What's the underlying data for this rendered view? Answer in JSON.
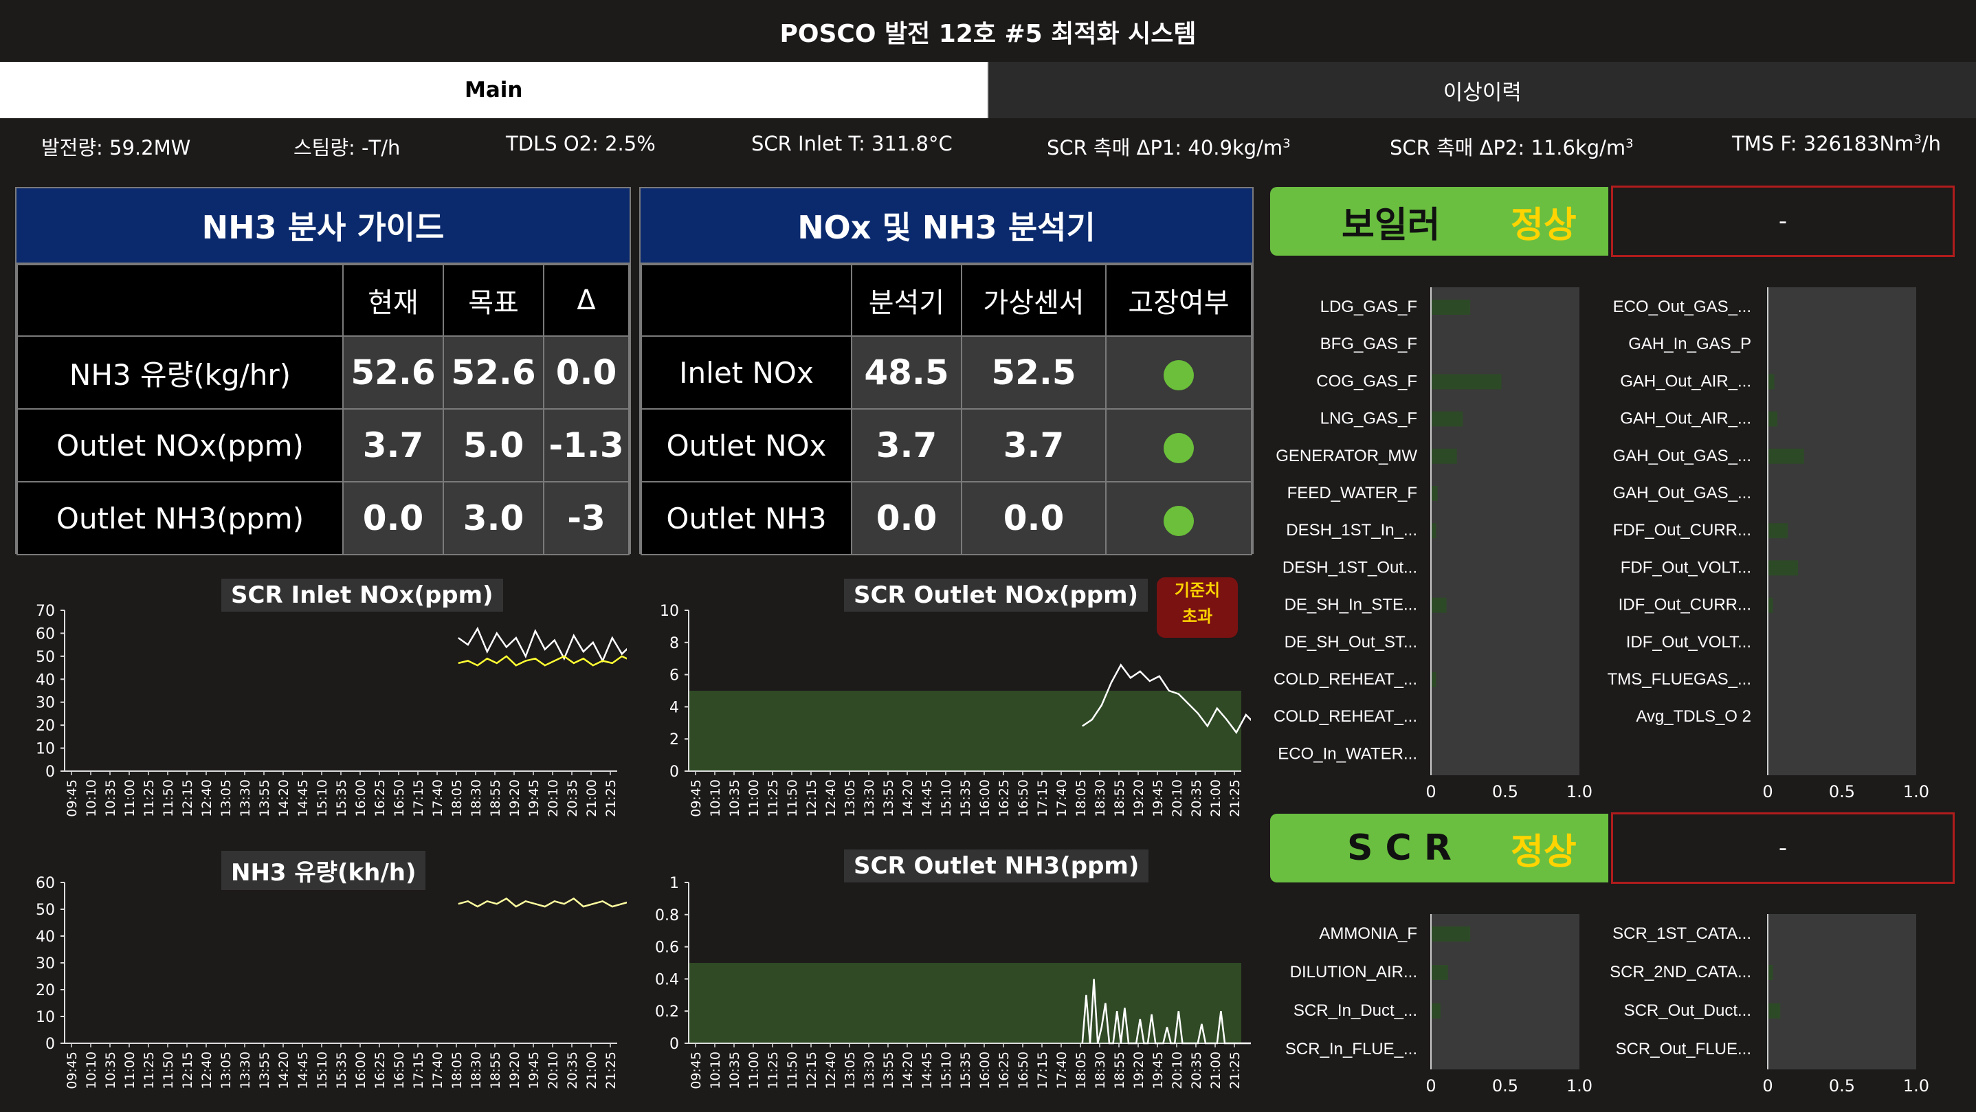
{
  "app": {
    "title": "POSCO 발전 12호 #5 최적화 시스템"
  },
  "tabs": [
    {
      "label": "Main"
    },
    {
      "label": "이상이력"
    }
  ],
  "status": {
    "power": "발전량: 59.2MW",
    "steam": "스팀량: -T/h",
    "o2": "TDLS O2: 2.5%",
    "inlet_t": "SCR Inlet T: 311.8°C",
    "dp1": "SCR 촉매 ΔP1: 40.9kg/m",
    "dp2": "SCR 촉매 ΔP2: 11.6kg/m",
    "tms": "TMS F: 326183Nm",
    "tms_unit": "/h",
    "sup3": "3"
  },
  "nh3_guide": {
    "title": "NH3 분사 가이드",
    "headers": [
      "현재",
      "목표",
      "Δ"
    ],
    "rows": [
      {
        "label": "NH3 유량(kg/hr)",
        "v": [
          "52.6",
          "52.6",
          "0.0"
        ]
      },
      {
        "label": "Outlet NOx(ppm)",
        "v": [
          "3.7",
          "5.0",
          "-1.3"
        ]
      },
      {
        "label": "Outlet NH3(ppm)",
        "v": [
          "0.0",
          "3.0",
          "-3"
        ]
      }
    ]
  },
  "analyzer": {
    "title": "NOx 및 NH3 분석기",
    "headers": [
      "분석기",
      "가상센서",
      "고장여부"
    ],
    "rows": [
      {
        "label": "Inlet NOx",
        "v": [
          "48.5",
          "52.5"
        ],
        "ok": true
      },
      {
        "label": "Outlet NOx",
        "v": [
          "3.7",
          "3.7"
        ],
        "ok": true
      },
      {
        "label": "Outlet NH3",
        "v": [
          "0.0",
          "0.0"
        ],
        "ok": true
      }
    ],
    "ok_color": "#6bbf3a"
  },
  "time_labels": [
    "09:45",
    "10:10",
    "10:35",
    "11:00",
    "11:25",
    "11:50",
    "12:15",
    "12:40",
    "13:05",
    "13:30",
    "13:55",
    "14:20",
    "14:45",
    "15:10",
    "15:35",
    "16:00",
    "16:25",
    "16:50",
    "17:15",
    "17:40",
    "18:05",
    "18:30",
    "18:55",
    "19:20",
    "19:45",
    "20:10",
    "20:35",
    "21:00",
    "21:25"
  ],
  "chart_data": [
    {
      "id": "inlet_nox",
      "type": "line",
      "title": "SCR Inlet NOx(ppm)",
      "ylim": [
        0,
        70
      ],
      "yticks": [
        0,
        10,
        20,
        30,
        40,
        50,
        60,
        70
      ],
      "series": [
        {
          "color": "#ffffff",
          "t": [
            20.1,
            20.6,
            21.1,
            21.6,
            22.1,
            22.6,
            23.1,
            23.6,
            24.1,
            24.6,
            25.1,
            25.6,
            26.1,
            26.6,
            27.1,
            27.6,
            28.1,
            28.6,
            29.1,
            29.6,
            30.1
          ],
          "values": [
            58,
            55,
            62,
            52,
            60,
            54,
            58,
            50,
            61,
            53,
            57,
            49,
            59,
            52,
            56,
            48,
            58,
            51,
            55,
            50,
            54
          ]
        },
        {
          "color": "#ffff33",
          "t": [
            20.1,
            20.6,
            21.1,
            21.6,
            22.1,
            22.6,
            23.1,
            23.6,
            24.1,
            24.6,
            25.1,
            25.6,
            26.1,
            26.6,
            27.1,
            27.6,
            28.1,
            28.6,
            29.1,
            29.6,
            30.1
          ],
          "values": [
            47,
            48,
            46,
            49,
            47,
            50,
            46,
            48,
            49,
            46,
            48,
            50,
            47,
            49,
            46,
            48,
            47,
            50,
            48,
            47,
            49
          ]
        }
      ]
    },
    {
      "id": "outlet_nox",
      "type": "line",
      "title": "SCR Outlet NOx(ppm)",
      "ylim": [
        0,
        10
      ],
      "yticks": [
        0,
        2,
        4,
        6,
        8,
        10
      ],
      "threshold": 5,
      "badge": [
        "기준치",
        "초과"
      ],
      "series": [
        {
          "color": "#ffffff",
          "t": [
            20.1,
            20.6,
            21.1,
            21.6,
            22.1,
            22.6,
            23.1,
            23.6,
            24.1,
            24.6,
            25.1,
            25.6,
            26.1,
            26.6,
            27.1,
            27.6,
            28.1,
            28.6,
            29.1,
            29.6,
            30.1
          ],
          "values": [
            2.8,
            3.2,
            4.1,
            5.5,
            6.6,
            5.8,
            6.2,
            5.6,
            5.9,
            5.0,
            4.8,
            4.2,
            3.6,
            2.8,
            3.9,
            3.2,
            2.4,
            3.5,
            2.9,
            3.8,
            3.7
          ]
        }
      ]
    },
    {
      "id": "nh3_flow",
      "type": "line",
      "title": "NH3 유량(kh/h)",
      "ylim": [
        0,
        60
      ],
      "yticks": [
        0,
        10,
        20,
        30,
        40,
        50,
        60
      ],
      "series": [
        {
          "color": "#ffffa0",
          "t": [
            20.1,
            20.6,
            21.1,
            21.6,
            22.1,
            22.6,
            23.1,
            23.6,
            24.1,
            24.6,
            25.1,
            25.6,
            26.1,
            26.6,
            27.1,
            27.6,
            28.1,
            28.6,
            29.1,
            29.6,
            30.1
          ],
          "values": [
            52,
            53,
            51,
            53,
            52,
            54,
            51,
            53,
            52,
            51,
            53,
            52,
            54,
            51,
            52,
            53,
            51,
            52,
            53,
            52,
            52
          ]
        }
      ]
    },
    {
      "id": "outlet_nh3",
      "type": "line",
      "title": "SCR Outlet NH3(ppm)",
      "ylim": [
        0,
        1.0
      ],
      "yticks": [
        0,
        0.2,
        0.4,
        0.6,
        0.8,
        1.0
      ],
      "threshold": 0.5,
      "series": [
        {
          "color": "#ffffff",
          "t": [
            20.1,
            20.3,
            20.5,
            20.7,
            20.9,
            21.1,
            21.3,
            21.5,
            21.7,
            21.9,
            22.1,
            22.3,
            22.5,
            22.7,
            22.9,
            23.1,
            23.3,
            23.5,
            23.7,
            23.9,
            24.1,
            24.3,
            24.5,
            24.7,
            24.9,
            25.1,
            25.3,
            25.5,
            25.7,
            25.9,
            26.1,
            26.3,
            26.5,
            26.7,
            26.9,
            27.1,
            27.3,
            27.5,
            27.7,
            27.9,
            28.1,
            28.3,
            28.5,
            28.7,
            28.9,
            29.1,
            29.3,
            29.5,
            29.7,
            29.9,
            30.1
          ],
          "values": [
            0,
            0.3,
            0,
            0.4,
            0,
            0.1,
            0.25,
            0,
            0,
            0.2,
            0,
            0.22,
            0,
            0,
            0,
            0.15,
            0,
            0,
            0.18,
            0,
            0,
            0,
            0.1,
            0,
            0,
            0.2,
            0,
            0,
            0,
            0,
            0,
            0.12,
            0,
            0,
            0,
            0,
            0.2,
            0,
            0,
            0,
            0,
            0,
            0,
            0,
            0,
            0,
            0,
            0,
            0,
            0,
            0
          ]
        }
      ]
    }
  ],
  "boiler": {
    "label": "보일러",
    "status": "정상",
    "message": "-",
    "xticks": [
      "0",
      "0.5",
      "1.0"
    ],
    "left": {
      "names": [
        "LDG_GAS_F",
        "BFG_GAS_F",
        "COG_GAS_F",
        "LNG_GAS_F",
        "GENERATOR_MW",
        "FEED_WATER_F",
        "DESH_1ST_In_...",
        "DESH_1ST_Out...",
        "DE_SH_In_STE...",
        "DE_SH_Out_ST...",
        "COLD_REHEAT_...",
        "COLD_REHEAT_...",
        "ECO_In_WATER..."
      ],
      "values": [
        0.26,
        0,
        0.47,
        0.21,
        0.17,
        0.04,
        0.03,
        0,
        0.1,
        0,
        0.03,
        0,
        0
      ]
    },
    "right": {
      "names": [
        "ECO_Out_GAS_...",
        "GAH_In_GAS_P",
        "GAH_Out_AIR_...",
        "GAH_Out_AIR_...",
        "GAH_Out_GAS_...",
        "GAH_Out_GAS_...",
        "FDF_Out_CURR...",
        "FDF_Out_VOLT...",
        "IDF_Out_CURR...",
        "IDF_Out_VOLT...",
        "TMS_FLUEGAS_...",
        "Avg_TDLS_O 2"
      ],
      "values": [
        0,
        0,
        0.04,
        0.06,
        0.24,
        0,
        0.13,
        0.2,
        0.03,
        0,
        0,
        0
      ]
    }
  },
  "scr": {
    "label": "S C R",
    "status": "정상",
    "message": "-",
    "xticks": [
      "0",
      "0.5",
      "1.0"
    ],
    "left": {
      "names": [
        "AMMONIA_F",
        "DILUTION_AIR...",
        "SCR_In_Duct_...",
        "SCR_In_FLUE_..."
      ],
      "values": [
        0.26,
        0.11,
        0.06,
        0
      ]
    },
    "right": {
      "names": [
        "SCR_1ST_CATA...",
        "SCR_2ND_CATA...",
        "SCR_Out_Duct...",
        "SCR_Out_FLUE..."
      ],
      "values": [
        0,
        0.03,
        0.08,
        0
      ]
    }
  },
  "colors": {
    "bar": "#2d4a27",
    "panel": "#3a3a3a",
    "threshold_fill": "#2f4a25",
    "status_green": "#6abf40",
    "status_yellow": "#ffd400",
    "alert_red": "#b01c1c"
  }
}
